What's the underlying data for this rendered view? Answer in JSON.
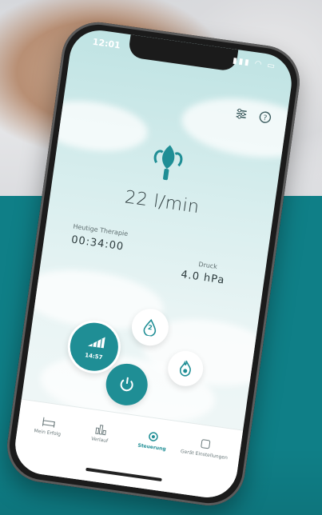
{
  "status_bar": {
    "time": "12:01"
  },
  "main": {
    "flow_value": "22 l/min",
    "therapy_label": "Heutige Therapie",
    "therapy_time": "00:34:00",
    "pressure_label": "Druck",
    "pressure_value": "4.0 hPa"
  },
  "controls": {
    "ramp_time": "14:57",
    "humidity_level": "2"
  },
  "tabbar": {
    "tabs": [
      {
        "label": "Mein Erfolg",
        "icon": "bed-icon"
      },
      {
        "label": "Verlauf",
        "icon": "bar-chart-icon"
      },
      {
        "label": "Steuerung",
        "icon": "control-icon",
        "active": true
      },
      {
        "label": "Gerät Einstellungen",
        "icon": "device-settings-icon"
      }
    ]
  },
  "colors": {
    "teal_accent": "#1f8e95",
    "background_teal": "#0f7f87",
    "screen_sky": "#bfe3e3"
  }
}
